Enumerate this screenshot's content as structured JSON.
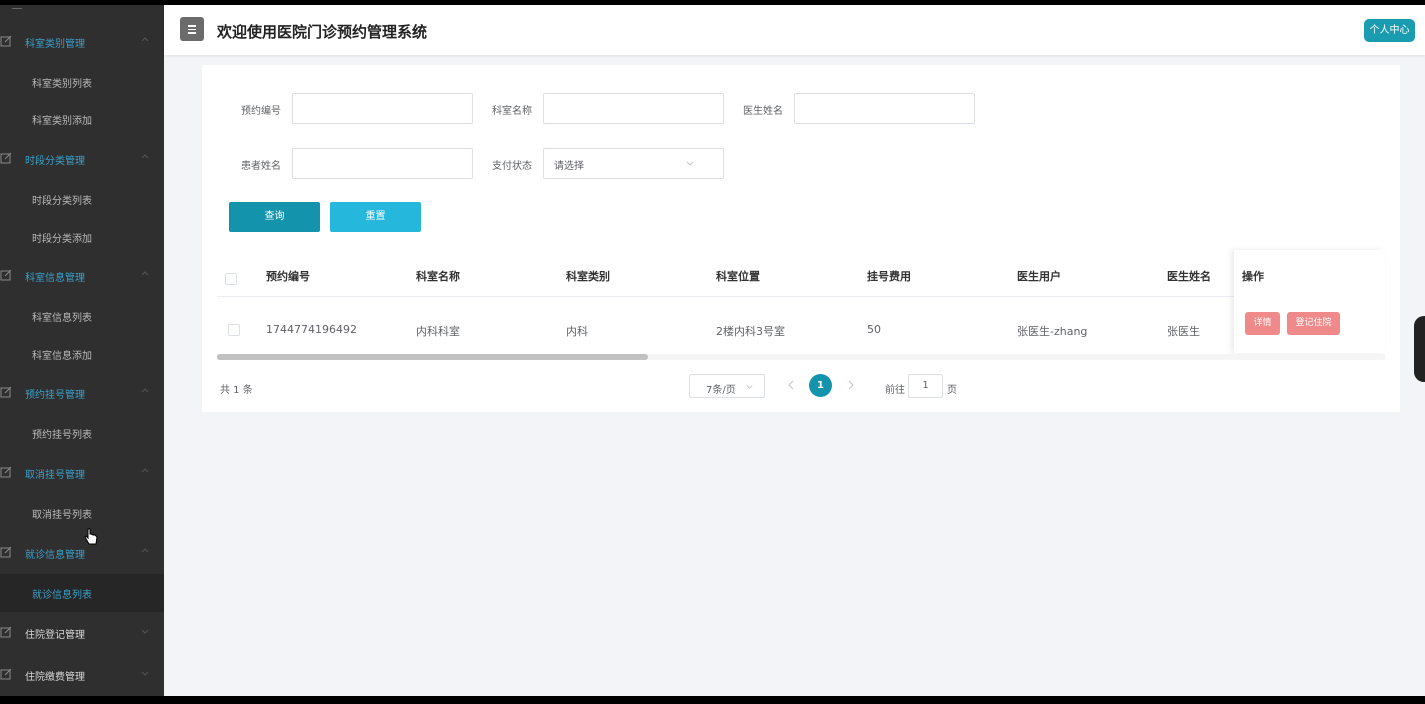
{
  "app": {
    "title": "欢迎使用医院门诊预约管理系统",
    "profile_button": "个人中心",
    "accent": "#1494ac"
  },
  "sidebar": {
    "groups": [
      {
        "label": "科室类别管理",
        "items": [
          "科室类别列表",
          "科室类别添加"
        ]
      },
      {
        "label": "时段分类管理",
        "items": [
          "时段分类列表",
          "时段分类添加"
        ]
      },
      {
        "label": "科室信息管理",
        "items": [
          "科室信息列表",
          "科室信息添加"
        ]
      },
      {
        "label": "预约挂号管理",
        "items": [
          "预约挂号列表"
        ]
      },
      {
        "label": "取消挂号管理",
        "items": [
          "取消挂号列表"
        ]
      },
      {
        "label": "就诊信息管理",
        "items": [
          "就诊信息列表"
        ]
      },
      {
        "label": "住院登记管理",
        "items": []
      },
      {
        "label": "住院缴费管理",
        "items": []
      }
    ],
    "active_item": "就诊信息列表"
  },
  "filters": {
    "appointment_no_label": "预约编号",
    "appointment_no_value": "",
    "dept_name_label": "科室名称",
    "dept_name_value": "",
    "doctor_name_label": "医生姓名",
    "doctor_name_value": "",
    "patient_name_label": "患者姓名",
    "patient_name_value": "",
    "pay_status_label": "支付状态",
    "pay_status_value": "请选择",
    "search_button": "查询",
    "reset_button": "重置"
  },
  "table": {
    "columns": [
      "预约编号",
      "科室名称",
      "科室类别",
      "科室位置",
      "挂号费用",
      "医生用户",
      "医生姓名",
      "操作"
    ],
    "rows": [
      {
        "appointment_no": "1744774196492",
        "dept_name": "内科科室",
        "dept_category": "内科",
        "dept_location": "2楼内科3号室",
        "fee": "50",
        "doctor_user": "张医生-zhang",
        "doctor_name": "张医生",
        "actions": [
          "详情",
          "登记住院"
        ]
      }
    ],
    "horizontal_scroll_fraction": 0.37
  },
  "pagination": {
    "total": "共 1 条",
    "page_size": "7条/页",
    "current_page": "1",
    "goto_label": "前往",
    "goto_value": "1",
    "page_suffix": "页"
  }
}
